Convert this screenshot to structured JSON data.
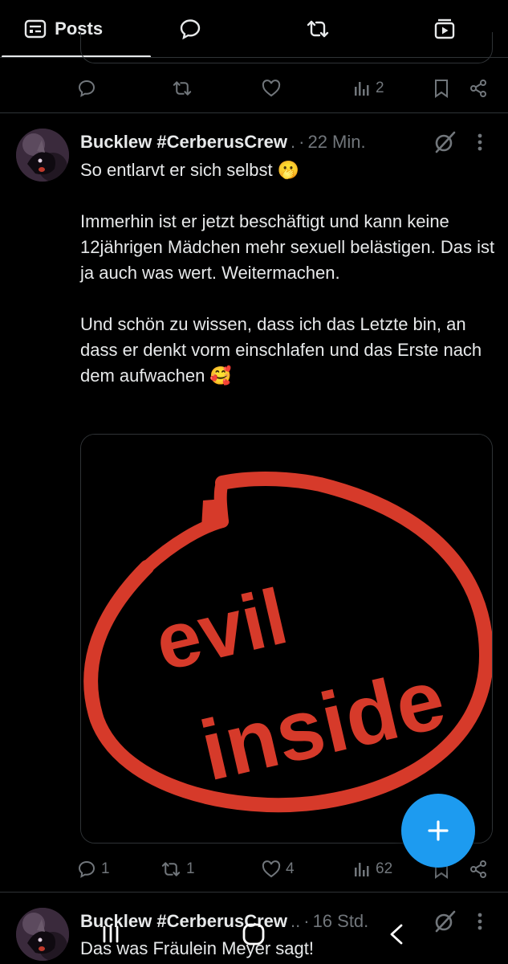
{
  "tabs": [
    {
      "label": "Posts",
      "icon": "posts-list-icon",
      "active": true
    },
    {
      "label": "",
      "icon": "replies-icon"
    },
    {
      "label": "",
      "icon": "repost-icon"
    },
    {
      "label": "",
      "icon": "media-icon"
    }
  ],
  "previous_post": {
    "actions": {
      "reply": "",
      "repost": "",
      "like": "",
      "views": "2"
    }
  },
  "post": {
    "author": "Bucklew #CerberusCrew",
    "truncation": ".",
    "separator": "·",
    "time": "22 Min.",
    "paragraphs": [
      "So entlarvt er sich selbst 🫢",
      "Immerhin ist er jetzt beschäftigt und kann keine 12jährigen Mädchen mehr sexuell belästigen. Das ist ja auch was wert. Weitermachen.",
      "Und schön zu wissen, dass ich das Letzte bin, an dass er denkt vorm einschlafen und das Erste nach dem aufwachen 🥰"
    ],
    "image_text": {
      "line1": "evil",
      "line2": "inside"
    },
    "actions": {
      "reply": "1",
      "repost": "1",
      "like": "4",
      "views": "62"
    }
  },
  "next_post": {
    "author": "Bucklew #CerberusCrew",
    "truncation": "..",
    "separator": "·",
    "time": "16 Std.",
    "text": "Das was Fräulein Meyer sagt!"
  },
  "fab": {
    "icon": "compose-plus-icon"
  },
  "android_nav": {
    "icons": [
      "recent-apps-icon",
      "home-icon",
      "back-icon"
    ]
  },
  "colors": {
    "background": "#000000",
    "text": "#e7e9ea",
    "muted": "#71767b",
    "accent": "#1d9bf0",
    "logo_red": "#d63a2a"
  }
}
